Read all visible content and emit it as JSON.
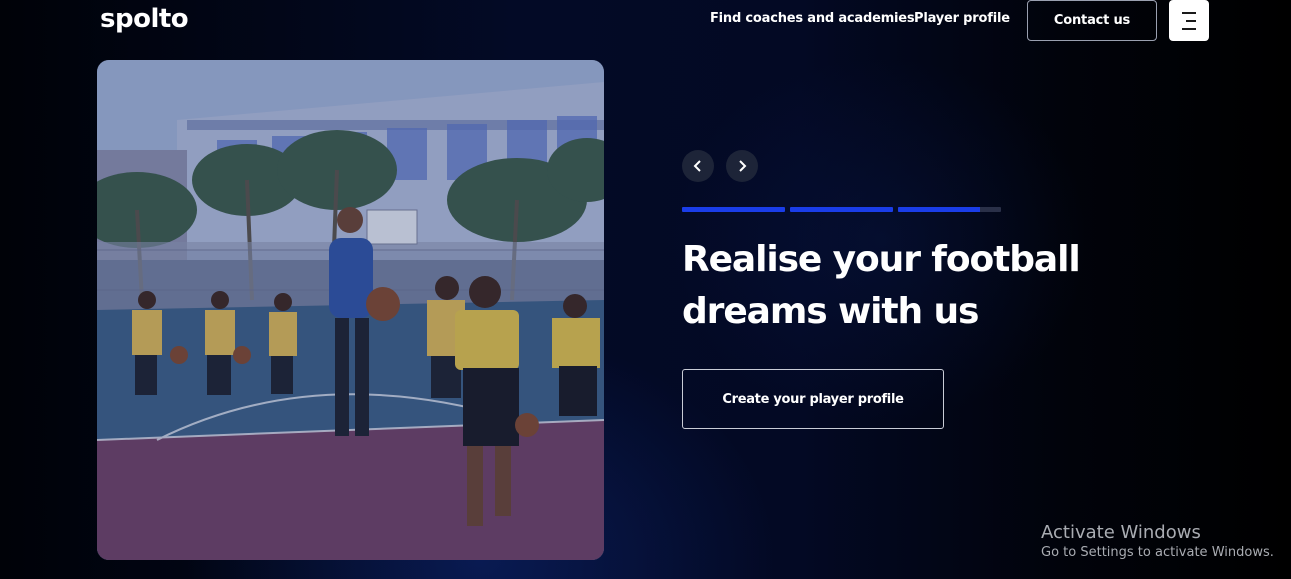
{
  "header": {
    "logo": "spolto",
    "nav": {
      "find_coaches": "Find coaches and academies",
      "player_profile": "Player profile"
    },
    "contact_label": "Contact us",
    "menu_icon": "hamburger-menu-icon"
  },
  "hero": {
    "image_icon": "basketball-practice-photo",
    "carousel": {
      "prev_icon": "chevron-left-icon",
      "next_icon": "chevron-right-icon",
      "progress": [
        1.0,
        1.0,
        0.8
      ]
    },
    "headline": "Realise your football dreams with us",
    "cta_label": "Create your player profile"
  },
  "watermark": {
    "title": "Activate Windows",
    "subtitle": "Go to Settings to activate Windows."
  },
  "colors": {
    "background": "#030a26",
    "accent": "#1a3de8",
    "button_bg": "#1d2438",
    "text": "#ffffff"
  }
}
